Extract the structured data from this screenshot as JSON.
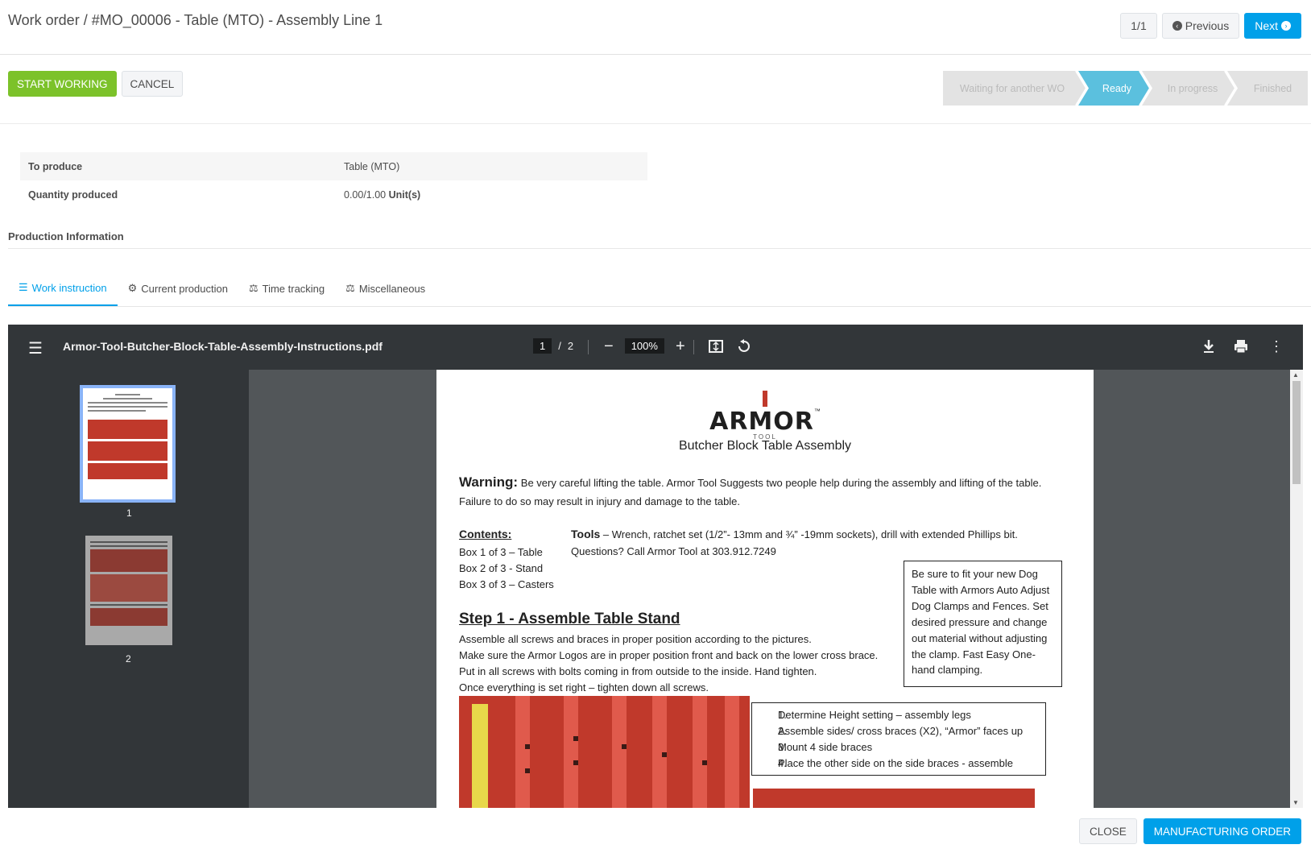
{
  "header": {
    "breadcrumb": "Work order / #MO_00006 - Table (MTO) - Assembly Line 1",
    "pager_count": "1/1",
    "previous_label": "Previous",
    "next_label": "Next"
  },
  "actions": {
    "start_label": "START WORKING",
    "cancel_label": "CANCEL"
  },
  "status": {
    "stages": [
      "Waiting for another WO",
      "Ready",
      "In progress",
      "Finished"
    ],
    "active": "Ready"
  },
  "info": {
    "to_produce_label": "To produce",
    "to_produce_value": "Table (MTO)",
    "quantity_label": "Quantity produced",
    "quantity_value": "0.00/1.00",
    "quantity_unit": "Unit(s)"
  },
  "production_info_title": "Production Information",
  "tabs": [
    {
      "label": "Work instruction",
      "icon": "list-icon"
    },
    {
      "label": "Current production",
      "icon": "cogs-icon"
    },
    {
      "label": "Time tracking",
      "icon": "balance-scale-icon"
    },
    {
      "label": "Miscellaneous",
      "icon": "balance-scale-icon"
    }
  ],
  "pdf": {
    "filename": "Armor-Tool-Butcher-Block-Table-Assembly-Instructions.pdf",
    "current_page": "1",
    "total_pages": "2",
    "zoom": "100%",
    "thumb_labels": [
      "1",
      "2"
    ],
    "doc": {
      "logo": "ARMOR",
      "logo_tm": "™",
      "logo_sub": "TOOL",
      "title": "Butcher Block Table Assembly",
      "warning_label": "Warning:",
      "warning_line1": "Be very careful lifting the table.  Armor Tool Suggests two people help during the assembly and lifting of the table.",
      "warning_line2": "Failure to do so may result in injury and damage to the table.",
      "contents_label": "Contents:",
      "contents_items": [
        "Box 1 of 3 – Table",
        "Box 2 of 3 - Stand",
        "Box 3 of 3 – Casters"
      ],
      "tools_label": "Tools",
      "tools_text": "– Wrench, ratchet set (1/2”- 13mm and ¾” -19mm sockets), drill with extended Phillips bit.",
      "questions": "Questions?  Call Armor Tool at 303.912.7249",
      "note_box": "Be sure to fit your new Dog Table with Armors Auto Adjust Dog Clamps and Fences.   Set desired pressure and change out material without adjusting the clamp. Fast Easy One-hand clamping.",
      "step1_title": "Step 1",
      "step1_subtitle": " - Assemble Table Stand",
      "step1_lines": [
        "Assemble all screws and braces in proper position according to the pictures.",
        "Make sure the Armor Logos are in proper position front and back on the lower cross brace.",
        "Put in all screws with bolts coming in from outside to the inside.   Hand tighten.",
        "Once everything is set right – tighten down all screws."
      ],
      "step1_list": [
        "Determine Height setting – assembly legs",
        "Assemble sides/ cross braces (X2), “Armor” faces up",
        "Mount 4 side braces",
        "Place the other side on the side braces - assemble"
      ]
    }
  },
  "footer": {
    "close_label": "CLOSE",
    "mo_label": "MANUFACTURING ORDER"
  },
  "colors": {
    "primary": "#00a0e9",
    "success": "#7cc22a",
    "stage_active": "#5bc0de"
  }
}
